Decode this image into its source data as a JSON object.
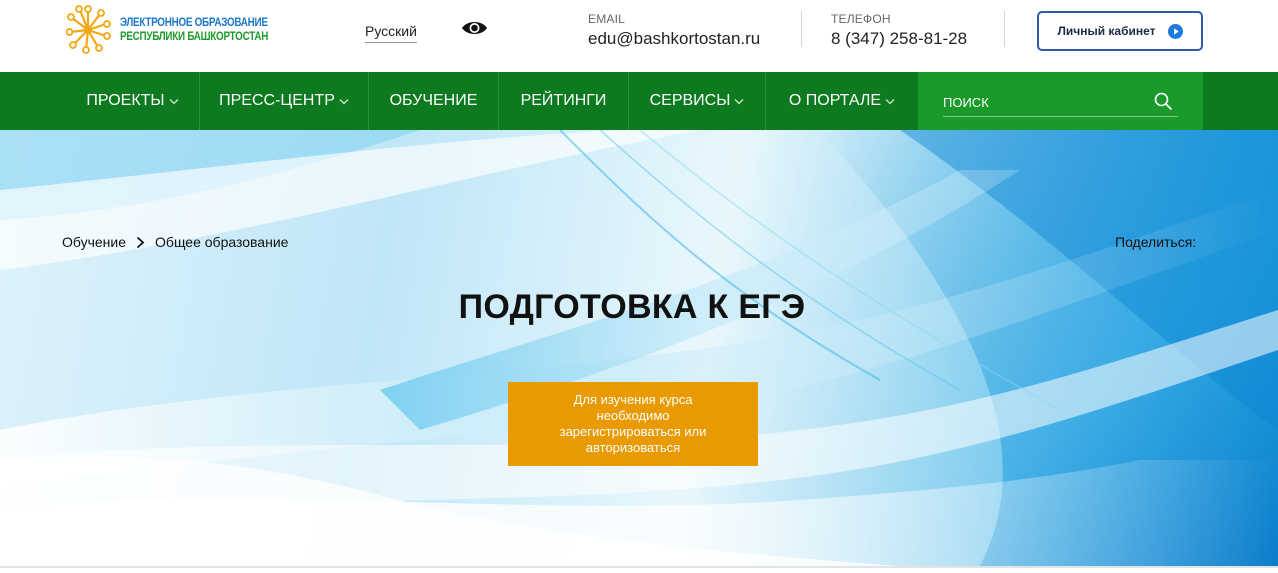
{
  "header": {
    "logo": {
      "line1": "ЭЛЕКТРОННОЕ ОБРАЗОВАНИЕ",
      "line2": "РЕСПУБЛИКИ БАШКОРТОСТАН",
      "icon": "sun-network-logo-icon"
    },
    "language": "Русский",
    "accessibility_icon": "eye-icon",
    "email": {
      "label": "EMAIL",
      "value": "edu@bashkortostan.ru"
    },
    "phone": {
      "label": "ТЕЛЕФОН",
      "value": "8 (347) 258-81-28"
    },
    "cabinet_button": {
      "label": "Личный кабинет",
      "icon": "play-circle-icon"
    }
  },
  "nav": {
    "items": [
      {
        "label": "ПРОЕКТЫ",
        "has_dropdown": true
      },
      {
        "label": "ПРЕСС-ЦЕНТР",
        "has_dropdown": true
      },
      {
        "label": "ОБУЧЕНИЕ",
        "has_dropdown": false
      },
      {
        "label": "РЕЙТИНГИ",
        "has_dropdown": false
      },
      {
        "label": "СЕРВИСЫ",
        "has_dropdown": true
      },
      {
        "label": "О ПОРТАЛЕ",
        "has_dropdown": true
      }
    ],
    "search": {
      "placeholder": "ПОИСК",
      "icon": "search-icon"
    }
  },
  "hero": {
    "breadcrumb": [
      "Обучение",
      "Общее образование"
    ],
    "share_label": "Поделиться:",
    "title": "ПОДГОТОВКА К ЕГЭ",
    "notice": "Для изучения курса необходимо зарегистрироваться или авторизоваться"
  },
  "colors": {
    "nav_bg": "#0d7a1f",
    "search_bg": "#199a2b",
    "notice_bg": "#e89a00",
    "logo_blue": "#1a77c9",
    "logo_green": "#1e9a2e",
    "cabinet_border": "#2e5aa8"
  }
}
